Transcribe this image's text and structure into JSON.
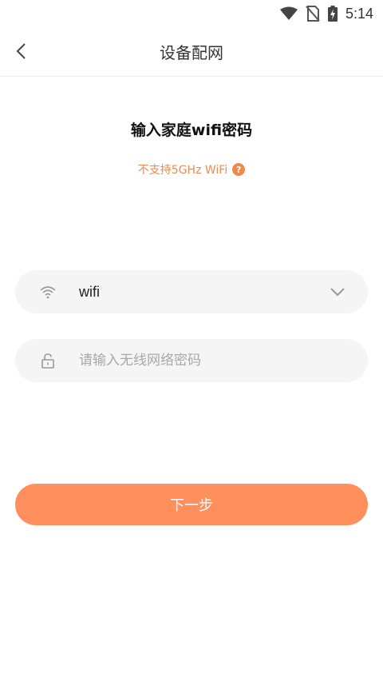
{
  "status_bar": {
    "time": "5:14",
    "icons": [
      "wifi-signal-icon",
      "no-sim-icon",
      "battery-charging-icon"
    ]
  },
  "header": {
    "title": "设备配网",
    "back_icon": "chevron-left-icon"
  },
  "main": {
    "heading": "输入家庭wifi密码",
    "notice": "不支持5GHz WiFi",
    "notice_icon": "question-circle-icon",
    "wifi_field": {
      "icon": "wifi-icon",
      "value": "wifi",
      "dropdown_icon": "chevron-down-icon"
    },
    "password_field": {
      "icon": "lock-icon",
      "placeholder": "请输入无线网络密码",
      "value": ""
    },
    "next_button": "下一步"
  },
  "colors": {
    "accent": "#ff8f5c",
    "notice": "#f08a4b",
    "field_bg": "#f5f5f5"
  }
}
